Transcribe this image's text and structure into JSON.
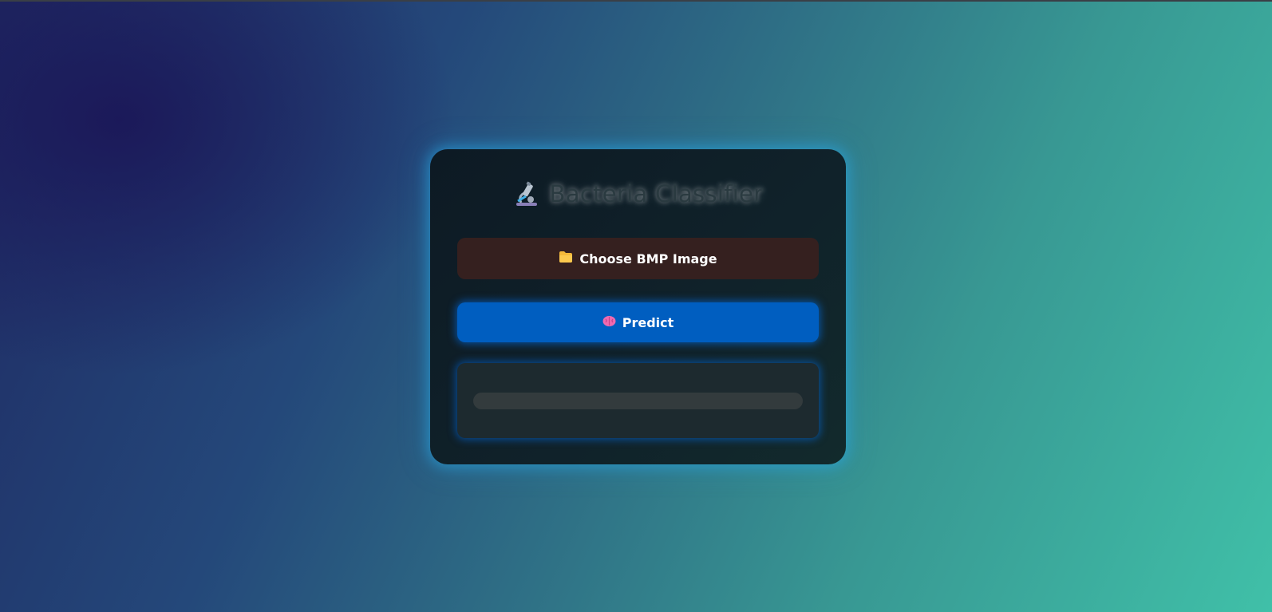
{
  "app": {
    "title": "Bacteria Classifier",
    "title_icon": "microscope-icon"
  },
  "upload": {
    "icon": "folder-icon",
    "label": "Choose BMP Image"
  },
  "predict": {
    "icon": "brain-icon",
    "label": "Predict"
  },
  "result": {
    "text": ""
  },
  "colors": {
    "upload_bg": "#35201f",
    "predict_bg": "#005ec0",
    "glow": "#28aae6"
  }
}
